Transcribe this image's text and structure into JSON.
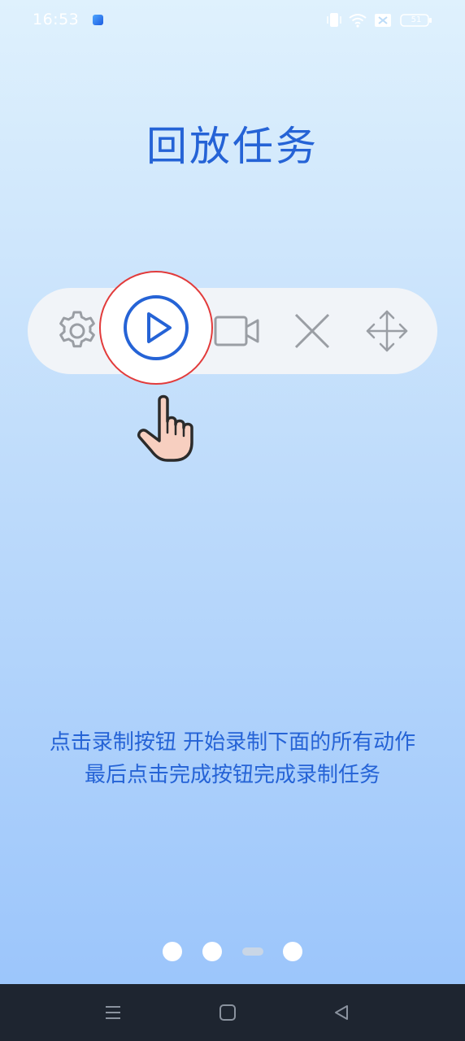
{
  "status_bar": {
    "time": "16:53",
    "battery": "51"
  },
  "title": "回放任务",
  "toolbar": {
    "icons": [
      "gear-icon",
      "play-icon",
      "video-camera-icon",
      "close-icon",
      "move-icon"
    ]
  },
  "instructions": {
    "line1": "点击录制按钮 开始录制下面的所有动作",
    "line2": "最后点击完成按钮完成录制任务"
  },
  "pager": {
    "total": 4,
    "current": 3
  },
  "colors": {
    "accent": "#2563d6",
    "highlight_ring": "#e23b3b",
    "icon_gray": "#9a9ea4",
    "nav_bar": "#1e2530"
  }
}
